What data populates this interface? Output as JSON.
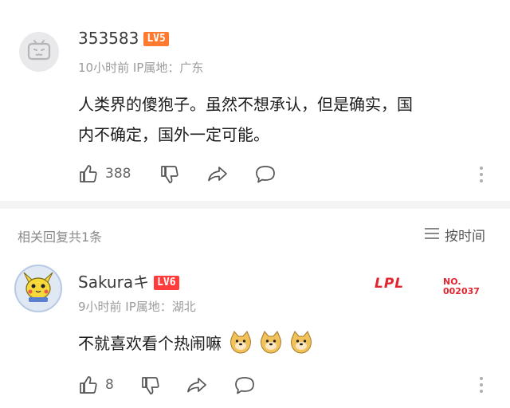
{
  "comment": {
    "username": "353583",
    "level": "LV5",
    "time_location": "10小时前 IP属地：广东",
    "content_line1": "人类界的傻狍子。虽然不想承认，但是确实，国",
    "content_line2": "内不确定，国外一定可能。",
    "like_count": "388"
  },
  "replies_section": {
    "header": "相关回复共1条",
    "sort_label": "按时间"
  },
  "reply": {
    "username": "Sakuraキ",
    "level": "LV6",
    "time_location": "9小时前 IP属地：湖北",
    "content": "不就喜欢看个热闹嘛",
    "like_count": "8",
    "badge_logo": "LPL",
    "badge_no_label": "NO.",
    "badge_no_value": "002037"
  },
  "colors": {
    "level5": "#ff7a2e",
    "level6": "#ff3b3b",
    "lpl_red": "#e0262f"
  }
}
